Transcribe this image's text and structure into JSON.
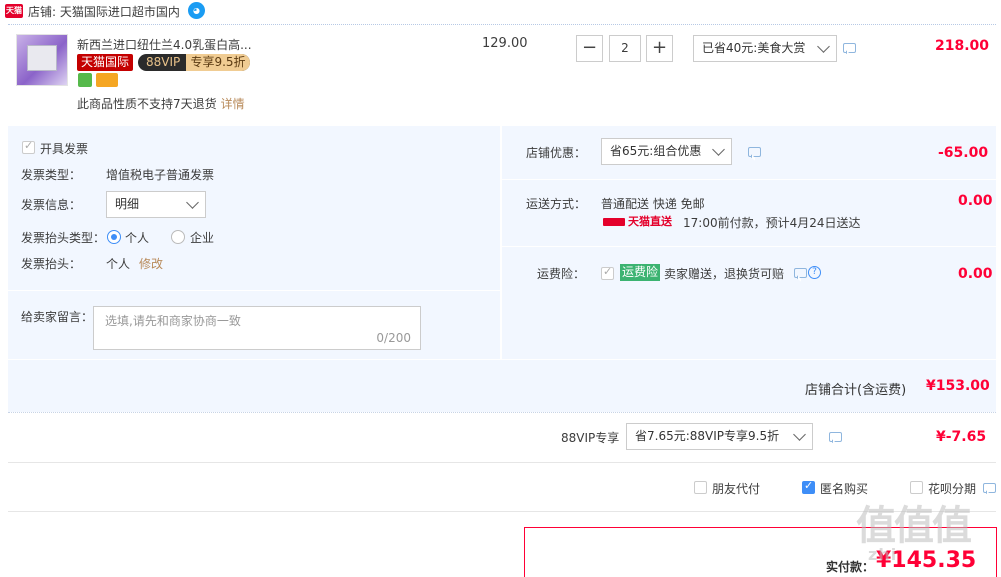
{
  "store": {
    "tmall_tag": "天猫",
    "label": "店铺: 天猫国际进口超市国内"
  },
  "item": {
    "title": "新西兰进口纽仕兰4.0乳蛋白高...",
    "badge_tmall": "天猫国际",
    "badge_vip": "88VIP",
    "badge_vip_discount": "专享9.5折",
    "notice": "此商品性质不支持7天退货",
    "notice_link": "详情",
    "unit_price": "129.00",
    "qty_minus": "−",
    "qty_value": "2",
    "qty_plus": "+",
    "promo_select": "已省40元:美食大赏",
    "subtotal": "218.00"
  },
  "invoice": {
    "open_label": "开具发票",
    "type_label": "发票类型：",
    "type_value": "增值税电子普通发票",
    "info_label": "发票信息：",
    "info_select": "明细",
    "head_type_label": "发票抬头类型：",
    "head_type_options": [
      "个人",
      "企业"
    ],
    "head_label": "发票抬头：",
    "head_value": "个人",
    "head_edit": "修改"
  },
  "message": {
    "label": "给卖家留言：",
    "placeholder": "选填,请先和商家协商一致",
    "count": "0/200"
  },
  "shop_discount": {
    "label": "店铺优惠：",
    "select": "省65元:组合优惠",
    "amount": "-65.00"
  },
  "shipping": {
    "label": "运送方式：",
    "method": "普通配送 快递 免邮",
    "tag": "天猫直送",
    "eta": "17:00前付款，预计4月24日送达",
    "amount": "0.00"
  },
  "insurance": {
    "label": "运费险：",
    "badge": "运费险",
    "desc": "卖家赠送，退换货可赔",
    "help": "?",
    "amount": "0.00"
  },
  "store_total": {
    "label": "店铺合计(含运费)",
    "amount": "¥153.00"
  },
  "vip": {
    "label": "88VIP专享",
    "select": "省7.65元:88VIP专享9.5折",
    "amount": "¥-7.65"
  },
  "options": {
    "friend_pay": "朋友代付",
    "anonymous": "匿名购买",
    "huabei": "花呗分期"
  },
  "pay": {
    "label": "实付款：",
    "amount": "¥145.35"
  },
  "watermark": {
    "main": "值值值",
    "sub": "zhi"
  },
  "colors": {
    "accent_red": "#ff0036",
    "panel_blue": "#f2f7ff",
    "checkbox_blue": "#3e8ef7"
  }
}
